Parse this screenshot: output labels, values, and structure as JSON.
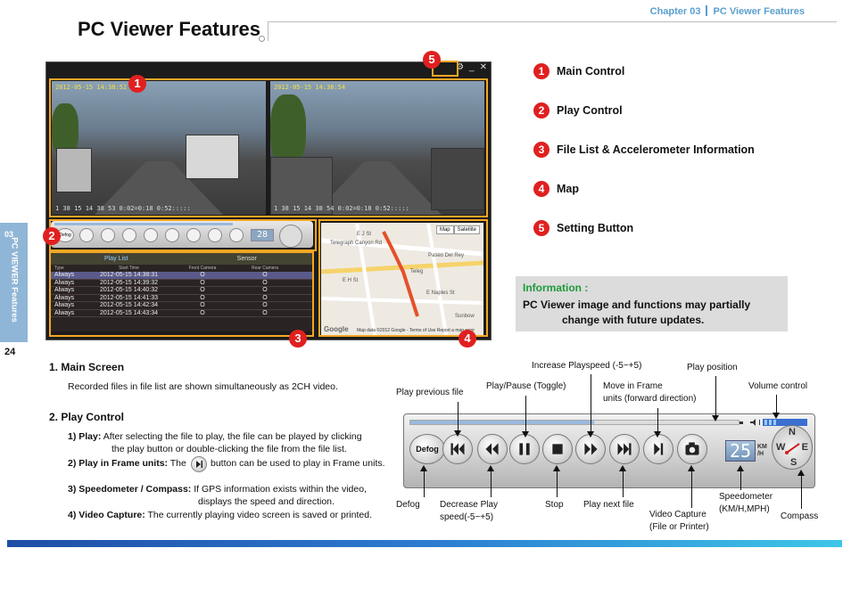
{
  "header": {
    "chapter": "Chapter 03",
    "section": "PC Viewer Features",
    "title": "PC Viewer Features"
  },
  "side_tab": {
    "number": "03",
    "label": "PC VIEWER Features"
  },
  "page_number": "24",
  "viewer": {
    "left_video": {
      "timestamp": "2012-05-15 14:38:52",
      "overlay": "1 38 15 14 38 53 0:02=0:18 0:52:::::"
    },
    "right_video": {
      "timestamp": "2012-05-15 14:38:54",
      "overlay": "1 38 15 14 38 54 0:02=0:18 0:52:::::"
    },
    "speed": "28",
    "defog": "Defog",
    "file_list": {
      "tabs": [
        "Play List",
        "Sensor"
      ],
      "columns": [
        "Type",
        "Start Time",
        "Front Camera",
        "Rear Camera"
      ],
      "rows": [
        [
          "Always",
          "2012-05-15 14:38:31",
          "O",
          "O"
        ],
        [
          "Always",
          "2012-05-15 14:39:32",
          "O",
          "O"
        ],
        [
          "Always",
          "2012-05-15 14:40:32",
          "O",
          "O"
        ],
        [
          "Always",
          "2012-05-15 14:41:33",
          "O",
          "O"
        ],
        [
          "Always",
          "2012-05-15 14:42:34",
          "O",
          "O"
        ],
        [
          "Always",
          "2012-05-15 14:43:34",
          "O",
          "O"
        ]
      ]
    },
    "map": {
      "buttons": [
        "Map",
        "Satellite"
      ],
      "logo": "Google",
      "credit": "Map data ©2012 Google - Terms of Use",
      "report": "Report a map error",
      "labels": [
        "Telegraph Canyon Rd",
        "Teleg",
        "Paseo Del Rey",
        "E J St",
        "E H St",
        "E Naples St",
        "Sunbow"
      ]
    },
    "badges": [
      "1",
      "2",
      "3",
      "4",
      "5"
    ]
  },
  "legend": [
    {
      "num": "1",
      "label": "Main Control"
    },
    {
      "num": "2",
      "label": "Play Control"
    },
    {
      "num": "3",
      "label": "File List & Accelerometer Information"
    },
    {
      "num": "4",
      "label": "Map"
    },
    {
      "num": "5",
      "label": "Setting Button"
    }
  ],
  "info": {
    "title": "Information :",
    "line1": "PC Viewer image and functions may partially",
    "line2": "change with future updates."
  },
  "sections": {
    "main_screen": {
      "title": "1. Main Screen",
      "text": "Recorded files in file list are shown simultaneously as 2CH video."
    },
    "play_control": {
      "title": "2. Play Control",
      "play_label": "1) Play:",
      "play_text": "After selecting the file to play, the file can be played by clicking",
      "play_text2": "the play button or double-clicking the file from the file list.",
      "frame_label": "2) Play in Frame units:",
      "frame_pre": "The",
      "frame_post": "button can be used to play in Frame units.",
      "speed_label": "3) Speedometer / Compass:",
      "speed_text": "If GPS information exists within the video,",
      "speed_text2": "displays the speed and direction.",
      "capture_label": "4) Video Capture:",
      "capture_text": "The currently playing video screen is saved or printed."
    }
  },
  "control_panel": {
    "defog": "Defog",
    "speed": "25",
    "unit_top": "KM",
    "unit_bottom": "/H",
    "compass": {
      "n": "N",
      "s": "S",
      "e": "E",
      "w": "W"
    }
  },
  "callouts": {
    "increase_speed": "Increase Playspeed (-5~+5)",
    "play_position": "Play position",
    "play_previous": "Play previous  file",
    "play_pause": "Play/Pause (Toggle)",
    "move_frame_1": "Move in Frame",
    "move_frame_2": "units (forward direction)",
    "volume": "Volume control",
    "defog": "Defog",
    "decrease_speed_1": "Decrease Play",
    "decrease_speed_2": "speed(-5~+5)",
    "stop": "Stop",
    "play_next": "Play next file",
    "video_capture_1": "Video Capture",
    "video_capture_2": "(File or Printer)",
    "speedometer_1": "Speedometer",
    "speedometer_2": "(KM/H,MPH)",
    "compass": "Compass"
  },
  "colors": {
    "accent": "#f5a623",
    "badge": "#e02020",
    "chapter": "#5aa0cf",
    "info_title": "#1e9a3a"
  }
}
